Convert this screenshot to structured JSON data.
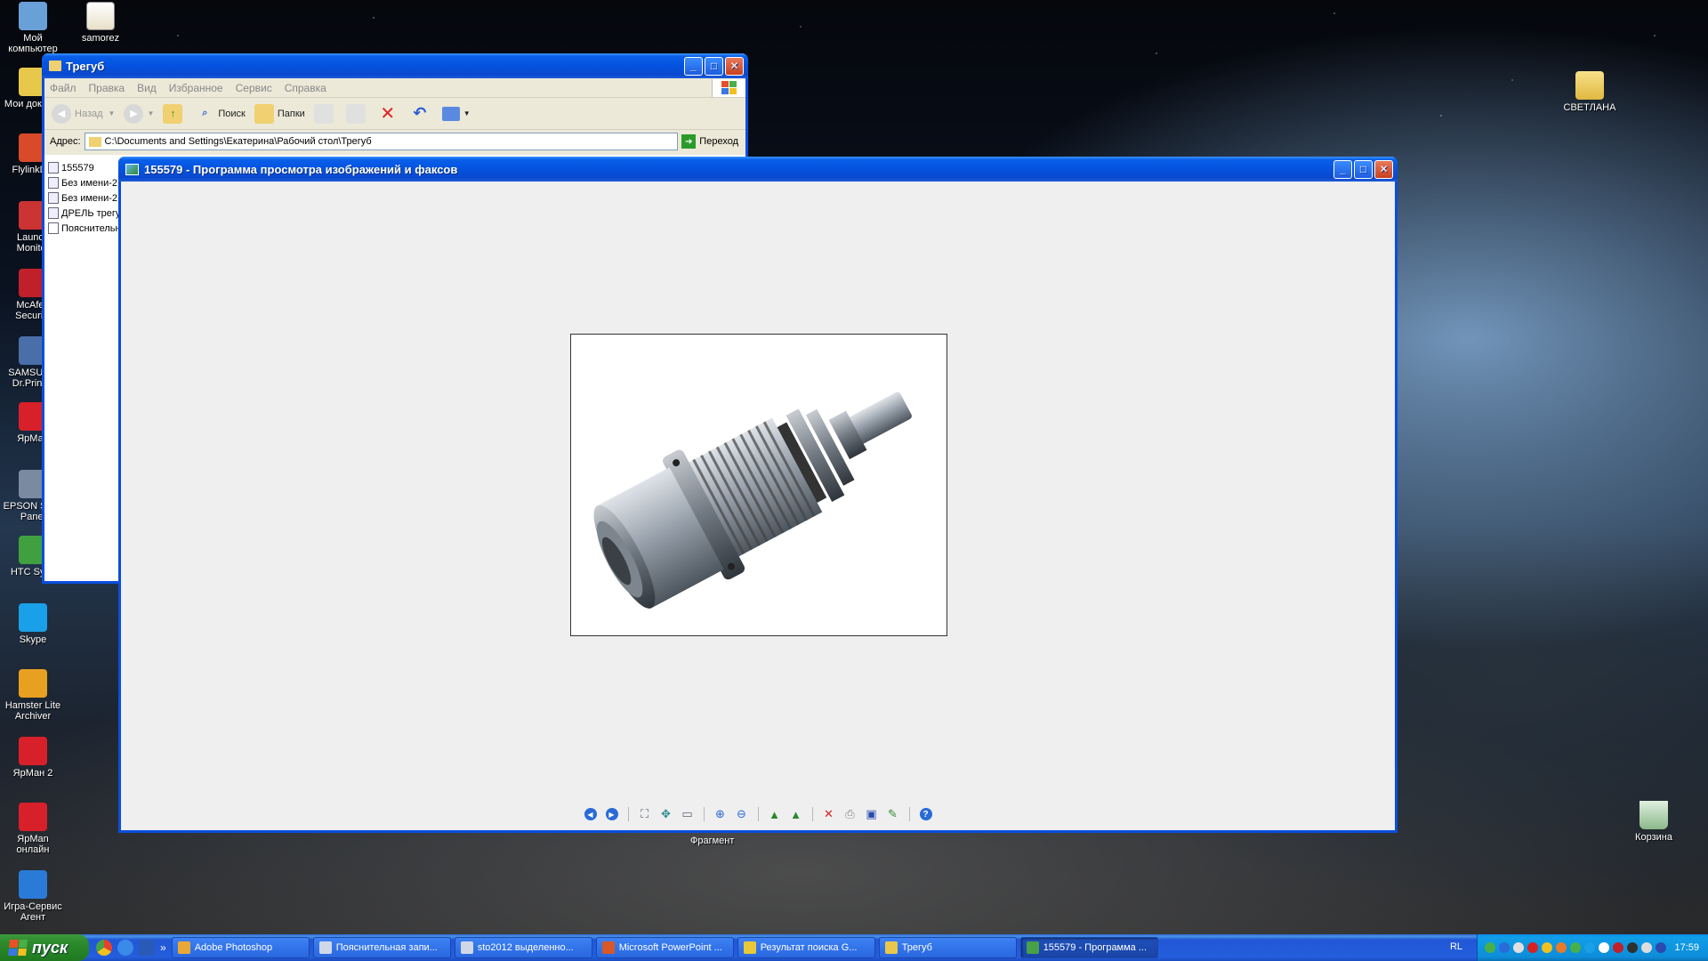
{
  "desktop": {
    "icons_left": [
      {
        "label": "Мой компьютер",
        "color": "#6aa0d8"
      },
      {
        "label": "Мои докум...",
        "color": "#e8c84a"
      },
      {
        "label": "FlylinkDC",
        "color": "#d84a2a"
      },
      {
        "label": "Launch Monitor",
        "color": "#cc3333"
      },
      {
        "label": "McAfee Security",
        "color": "#c0202a"
      },
      {
        "label": "SAMSUNG Dr.Printer",
        "color": "#4a6ea8"
      },
      {
        "label": "ЯрМан",
        "color": "#d8202a"
      },
      {
        "label": "EPSON Scan Panel",
        "color": "#7a8aa0"
      },
      {
        "label": "HTC Sync",
        "color": "#40a040"
      },
      {
        "label": "Skype",
        "color": "#1aa0e8"
      },
      {
        "label": "Hamster Lite Archiver",
        "color": "#e8a020"
      },
      {
        "label": "ЯрМан 2",
        "color": "#d8202a"
      },
      {
        "label": "ЯрMan онлайн",
        "color": "#d8202a"
      },
      {
        "label": "Игра-Сервис Агент",
        "color": "#2a7ad8"
      }
    ],
    "icon_samorez": "samorez",
    "icon_svetlana": "СВЕТЛАНА",
    "icon_recycle": "Корзина"
  },
  "explorer": {
    "title": "Трегуб",
    "menu": [
      "Файл",
      "Правка",
      "Вид",
      "Избранное",
      "Сервис",
      "Справка"
    ],
    "toolbar": {
      "back": "Назад",
      "search": "Поиск",
      "folders": "Папки"
    },
    "address_label": "Адрес:",
    "address_value": "C:\\Documents and Settings\\Екатерина\\Рабочий стол\\Трегуб",
    "go_label": "Переход",
    "files": [
      "155579",
      "Без имени-2",
      "Без имени-2",
      "ДРЕЛЬ трегу",
      "Пояснительн"
    ]
  },
  "viewer": {
    "title": "155579 - Программа просмотра изображений и факсов",
    "tooltip": "Фрагмент",
    "tools": [
      "prev-icon",
      "next-icon",
      "best-fit-icon",
      "actual-size-icon",
      "slideshow-icon",
      "zoom-in-icon",
      "zoom-out-icon",
      "rotate-cw-icon",
      "rotate-ccw-icon",
      "delete-icon",
      "print-icon",
      "save-icon",
      "edit-icon",
      "help-icon"
    ]
  },
  "taskbar": {
    "start": "пуск",
    "tasks": [
      {
        "label": "Adobe Photoshop",
        "color": "#e8a838"
      },
      {
        "label": "Пояснительная запи...",
        "color": "#d0d8e8"
      },
      {
        "label": "sto2012 выделенно...",
        "color": "#d0d8e8"
      },
      {
        "label": "Microsoft PowerPoint ...",
        "color": "#d8582a"
      },
      {
        "label": "Результат поиска G...",
        "color": "#e8c838"
      },
      {
        "label": "Трегуб",
        "color": "#e8c84a"
      },
      {
        "label": "155579 - Программа ...",
        "color": "#48a048"
      }
    ],
    "lang": "RL",
    "clock": "17:59"
  }
}
